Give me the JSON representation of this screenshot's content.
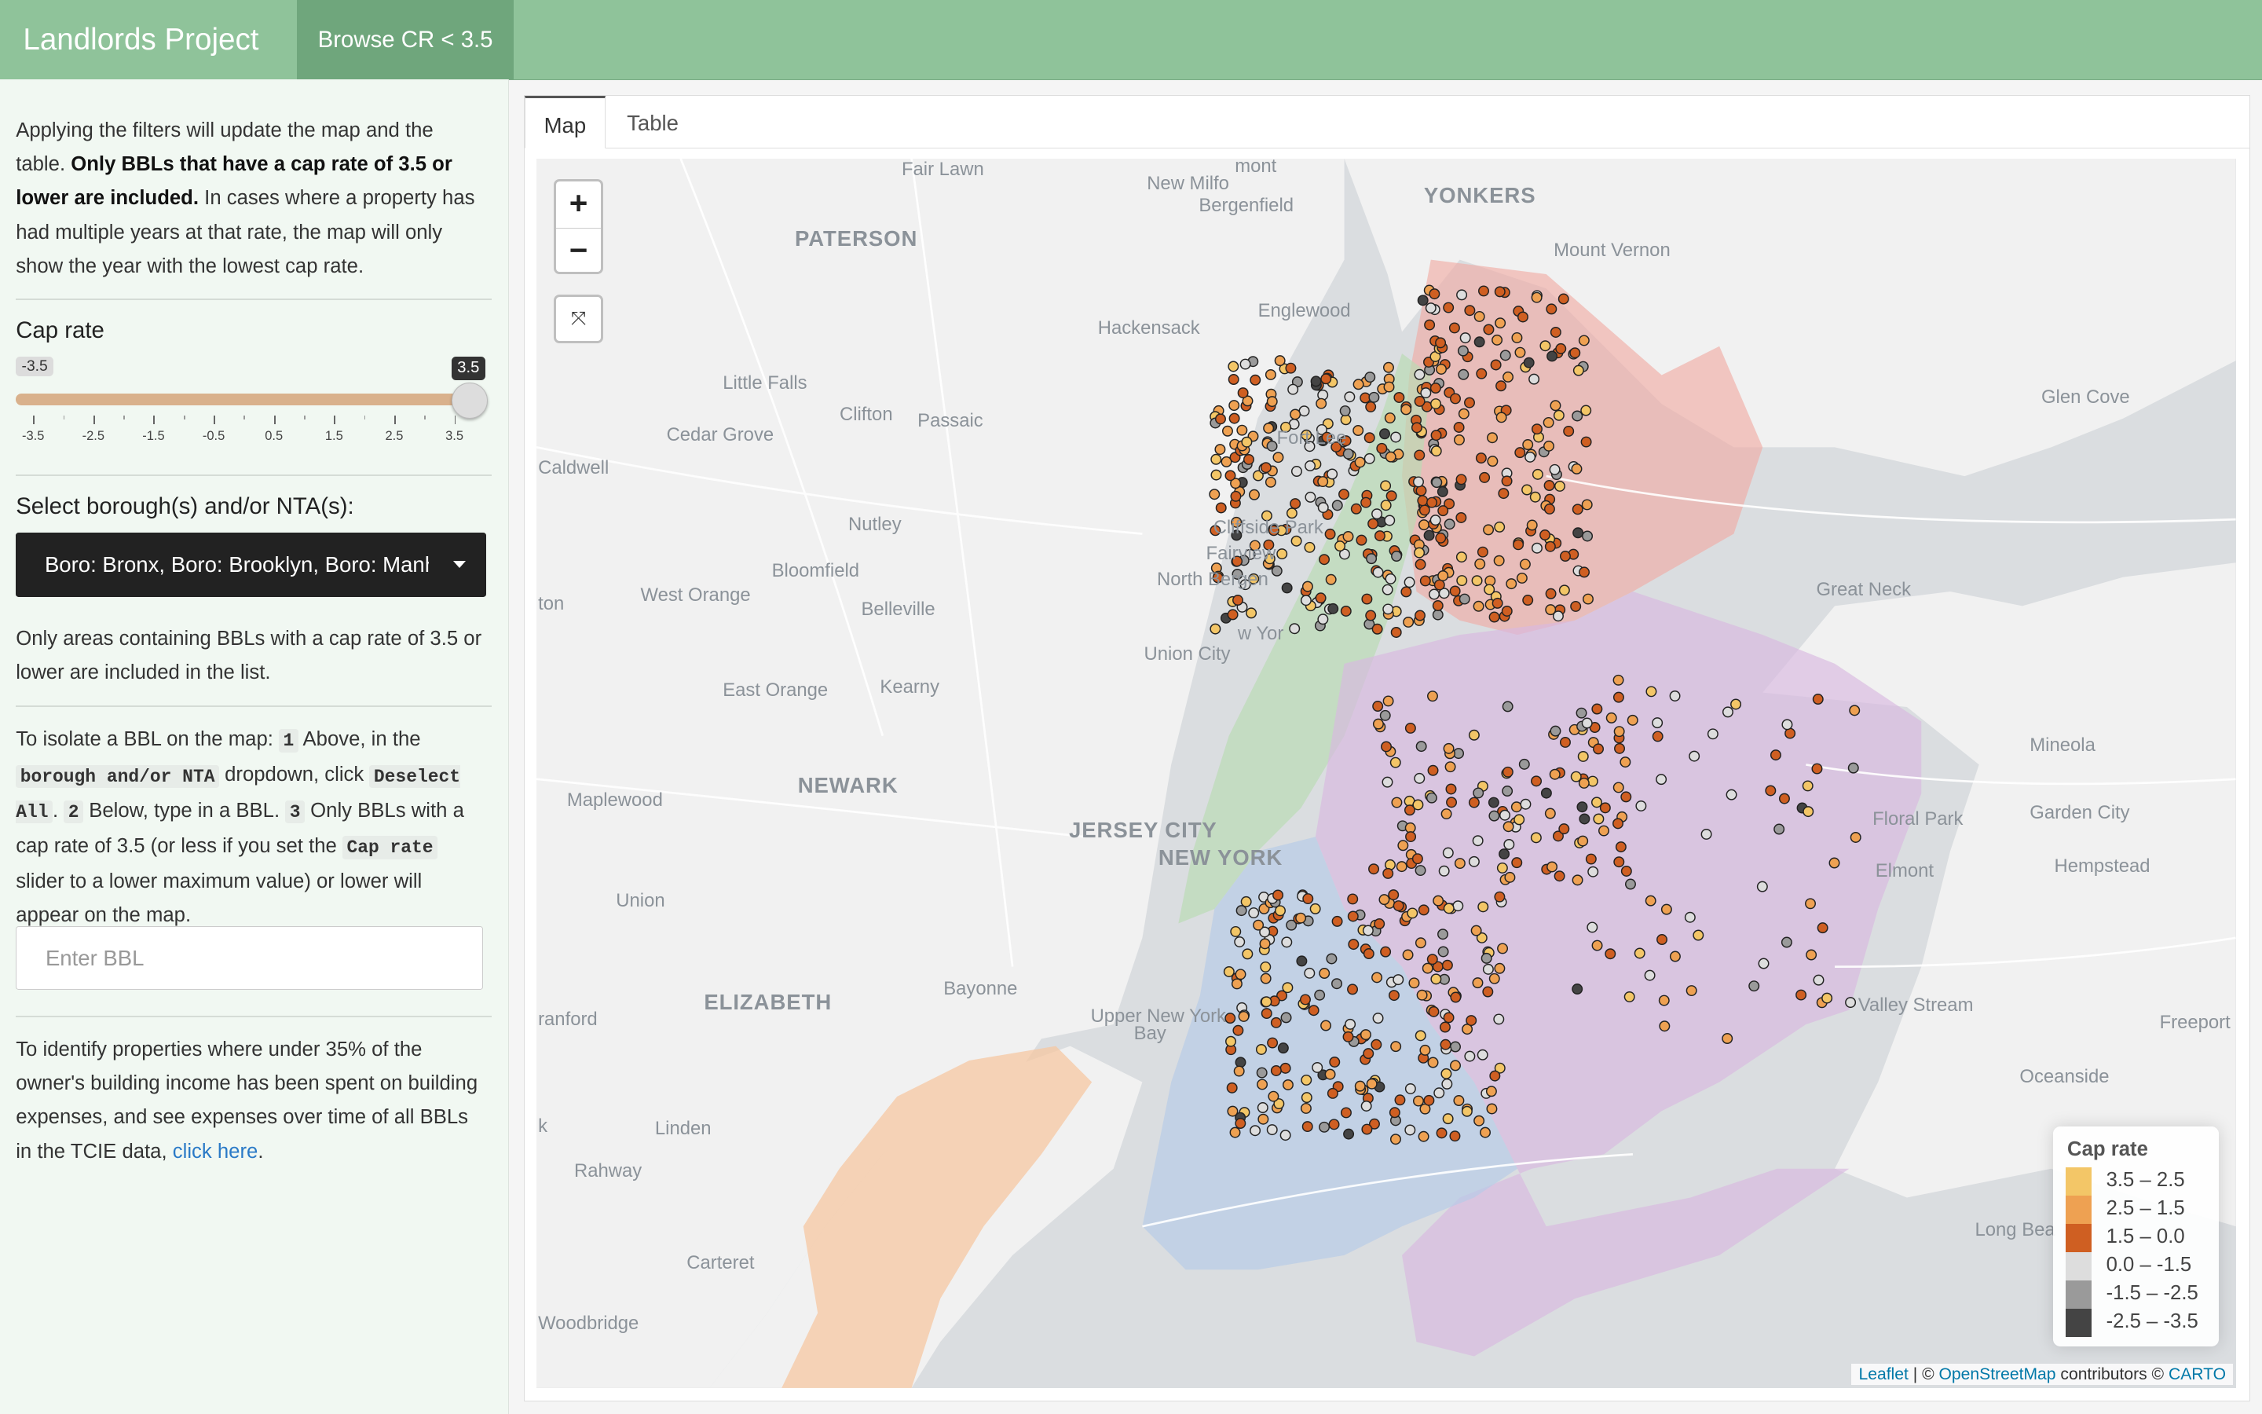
{
  "navbar": {
    "brand": "Landlords Project",
    "tab": "Browse CR < 3.5"
  },
  "sidebar": {
    "intro_prefix": "Applying the filters will update the map and the table. ",
    "intro_bold": "Only BBLs that have a cap rate of 3.5 or lower are included.",
    "intro_suffix": " In cases where a property has had multiple years at that rate, the map will only show the year with the lowest cap rate.",
    "cap_rate_label": "Cap rate",
    "slider": {
      "min_label": "-3.5",
      "max_label": "3.5",
      "range": [
        -3.5,
        3.5
      ],
      "value": [
        -3.5,
        3.5
      ],
      "ticks": [
        "-3.5",
        "-2.5",
        "-1.5",
        "-0.5",
        "0.5",
        "1.5",
        "2.5",
        "3.5"
      ]
    },
    "borough_label": "Select borough(s) and/or NTA(s):",
    "borough_value": "Boro: Bronx, Boro: Brooklyn, Boro: Manhattan",
    "borough_note": "Only areas containing BBLs with a cap rate of 3.5 or lower are included in the list.",
    "isolate": {
      "t1": "To isolate a BBL on the map: ",
      "s1": "1",
      "t2": " Above, in the ",
      "c1": "borough and/or NTA",
      "t3": " dropdown, click ",
      "c2": "Deselect All",
      "t4": ". ",
      "s2": "2",
      "t5": " Below, type in a BBL. ",
      "s3": "3",
      "t6": " Only BBLs with a cap rate of 3.5 (or less if you set the ",
      "c3": "Cap rate",
      "t7": " slider to a lower maximum value) or lower will appear on the map."
    },
    "bbl_placeholder": "Enter BBL",
    "identify_text": "To identify properties where under 35% of the owner's building income has been spent on building expenses, and see expenses over time of all BBLs in the TCIE data, ",
    "identify_link": "click here",
    "identify_end": "."
  },
  "tabs": [
    "Map",
    "Table"
  ],
  "map": {
    "zoom_in": "+",
    "zoom_out": "−",
    "reset": "⤧",
    "places": [
      {
        "name": "Fair Lawn"
      },
      {
        "name": "New Milfo"
      },
      {
        "name": "mont"
      },
      {
        "name": "YONKERS"
      },
      {
        "name": "Bergenfield"
      },
      {
        "name": "PATERSON"
      },
      {
        "name": "Mount Vernon"
      },
      {
        "name": "Englewood"
      },
      {
        "name": "Hackensack"
      },
      {
        "name": "Little Falls"
      },
      {
        "name": "Clifton"
      },
      {
        "name": "Passaic"
      },
      {
        "name": "Glen Cove"
      },
      {
        "name": "Cedar Grove"
      },
      {
        "name": "Fort Lee"
      },
      {
        "name": "Caldwell"
      },
      {
        "name": "Nutley"
      },
      {
        "name": "Cliffside Park"
      },
      {
        "name": "Fairview"
      },
      {
        "name": "Bloomfield"
      },
      {
        "name": "North Bergen"
      },
      {
        "name": "West Orange"
      },
      {
        "name": "Great Neck"
      },
      {
        "name": "ton"
      },
      {
        "name": "Belleville"
      },
      {
        "name": "w Yor"
      },
      {
        "name": "Union City"
      },
      {
        "name": "Kearny"
      },
      {
        "name": "East Orange"
      },
      {
        "name": "Mineola"
      },
      {
        "name": "NEWARK"
      },
      {
        "name": "Maplewood"
      },
      {
        "name": "JERSEY CITY"
      },
      {
        "name": "NEW YORK"
      },
      {
        "name": "Floral Park"
      },
      {
        "name": "Garden City"
      },
      {
        "name": "Hempstead"
      },
      {
        "name": "Elmont"
      },
      {
        "name": "Union"
      },
      {
        "name": "Bayonne"
      },
      {
        "name": "ELIZABETH"
      },
      {
        "name": "Upper New York"
      },
      {
        "name": "Bay"
      },
      {
        "name": "ranford"
      },
      {
        "name": "Valley Stream"
      },
      {
        "name": "Freeport"
      },
      {
        "name": "Oceanside"
      },
      {
        "name": "Linden"
      },
      {
        "name": "k"
      },
      {
        "name": "Rahway"
      },
      {
        "name": "Long Bea"
      },
      {
        "name": "Carteret"
      },
      {
        "name": "Woodbridge"
      }
    ],
    "legend": {
      "title": "Cap rate",
      "items": [
        {
          "label": "3.5 – 2.5",
          "color": "#f3c667"
        },
        {
          "label": "2.5 – 1.5",
          "color": "#eea152"
        },
        {
          "label": "1.5 – 0.0",
          "color": "#cf5f22"
        },
        {
          "label": "0.0 – -1.5",
          "color": "#dddddd"
        },
        {
          "label": "-1.5 – -2.5",
          "color": "#9a9a9a"
        },
        {
          "label": "-2.5 – -3.5",
          "color": "#444444"
        }
      ]
    },
    "attribution": {
      "leaflet": "Leaflet",
      "sep1": " | © ",
      "osm": "OpenStreetMap",
      "mid": " contributors © ",
      "carto": "CARTO"
    },
    "colors": {
      "bronx": "#f2a9a0",
      "manhattan": "#b8dcb2",
      "brooklyn": "#b6cbe8",
      "queens": "#d8b9e0",
      "staten": "#f6c7a1"
    }
  }
}
